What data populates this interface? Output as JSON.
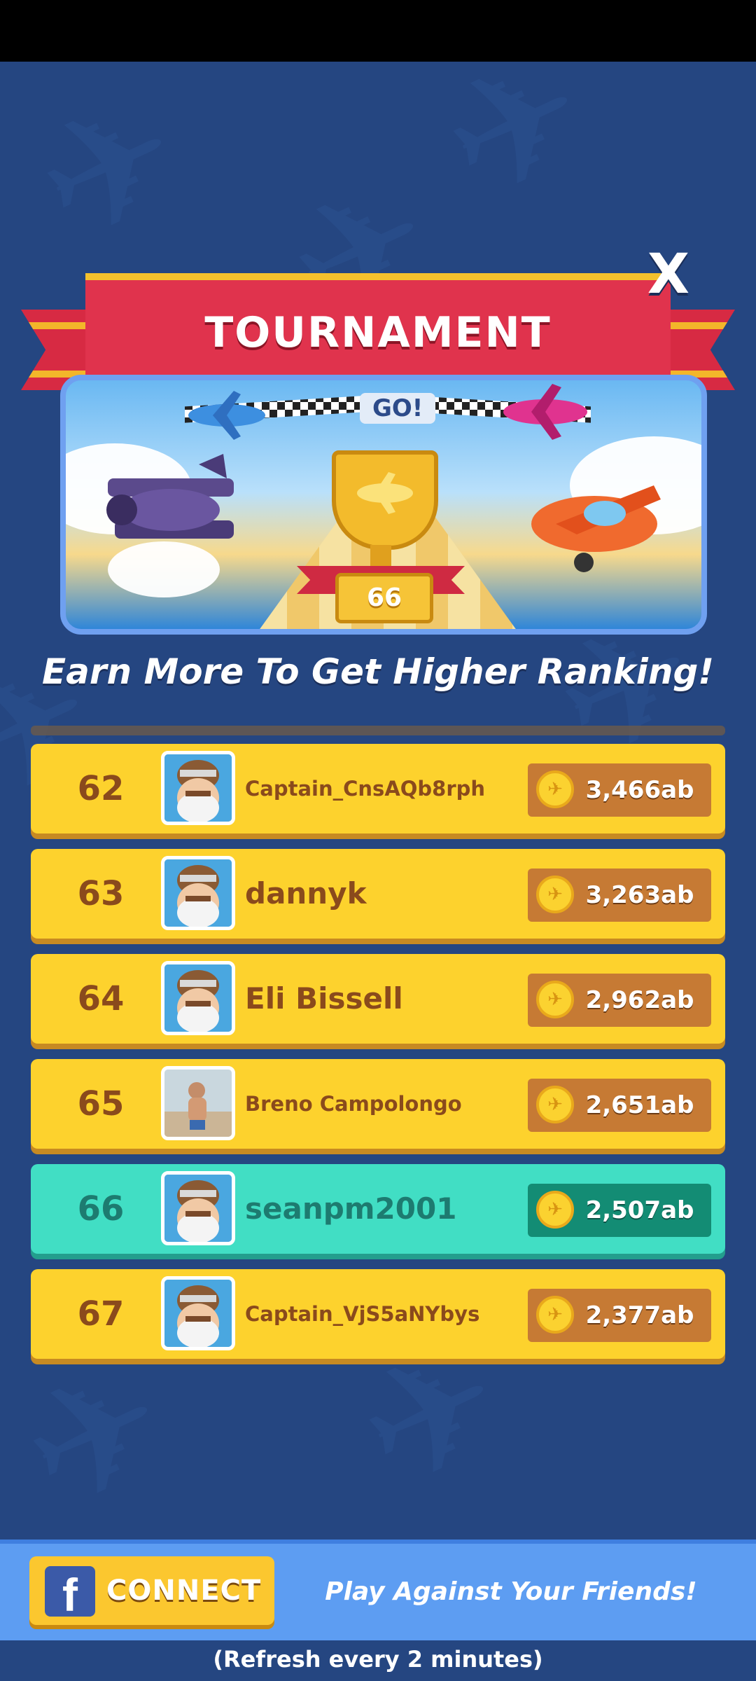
{
  "header": {
    "title": "TOURNAMENT",
    "close_label": "X"
  },
  "banner": {
    "go_text": "GO!",
    "trophy_rank": "66"
  },
  "subtitle": "Earn More To Get Higher Ranking!",
  "leaderboard": [
    {
      "rank": "62",
      "name": "Captain_CnsAQb8rph",
      "score": "3,466ab",
      "avatar": "pilot",
      "current_user": false
    },
    {
      "rank": "63",
      "name": "dannyk",
      "score": "3,263ab",
      "avatar": "pilot",
      "current_user": false
    },
    {
      "rank": "64",
      "name": "Eli Bissell",
      "score": "2,962ab",
      "avatar": "pilot",
      "current_user": false
    },
    {
      "rank": "65",
      "name": "Breno Campolongo",
      "score": "2,651ab",
      "avatar": "photo",
      "current_user": false
    },
    {
      "rank": "66",
      "name": "seanpm2001",
      "score": "2,507ab",
      "avatar": "pilot",
      "current_user": true
    },
    {
      "rank": "67",
      "name": "Captain_VjS5aNYbys",
      "score": "2,377ab",
      "avatar": "pilot",
      "current_user": false
    }
  ],
  "footer": {
    "connect_label": "CONNECT",
    "friends_text": "Play Against Your Friends!",
    "refresh_text": "(Refresh every 2 minutes)"
  },
  "colors": {
    "background": "#254681",
    "row": "#fdd22d",
    "row_current": "#41dec4",
    "ribbon": "#e0334d"
  }
}
